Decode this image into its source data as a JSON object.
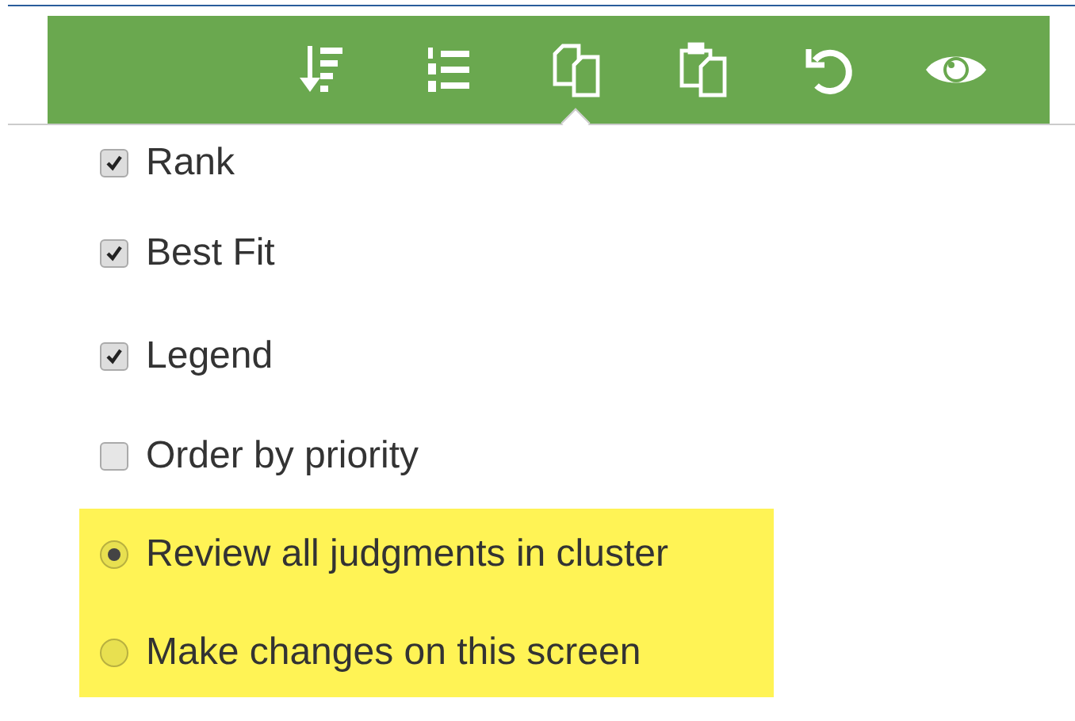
{
  "toolbar": {
    "tools": [
      {
        "kind": "sort",
        "selected": false
      },
      {
        "kind": "numbered-list",
        "selected": false
      },
      {
        "kind": "copy",
        "selected": true
      },
      {
        "kind": "paste",
        "selected": false
      },
      {
        "kind": "undo",
        "selected": false
      },
      {
        "kind": "view",
        "selected": false
      }
    ]
  },
  "checkboxes": [
    {
      "label": "Rank",
      "checked": true
    },
    {
      "label": "Best Fit",
      "checked": true
    },
    {
      "label": "Legend",
      "checked": true
    },
    {
      "label": "Order by priority",
      "checked": false
    }
  ],
  "radio_group": {
    "highlighted": true,
    "items": [
      {
        "label": "Review all judgments in cluster",
        "selected": true
      },
      {
        "label": "Make changes on this screen",
        "selected": false
      }
    ]
  }
}
